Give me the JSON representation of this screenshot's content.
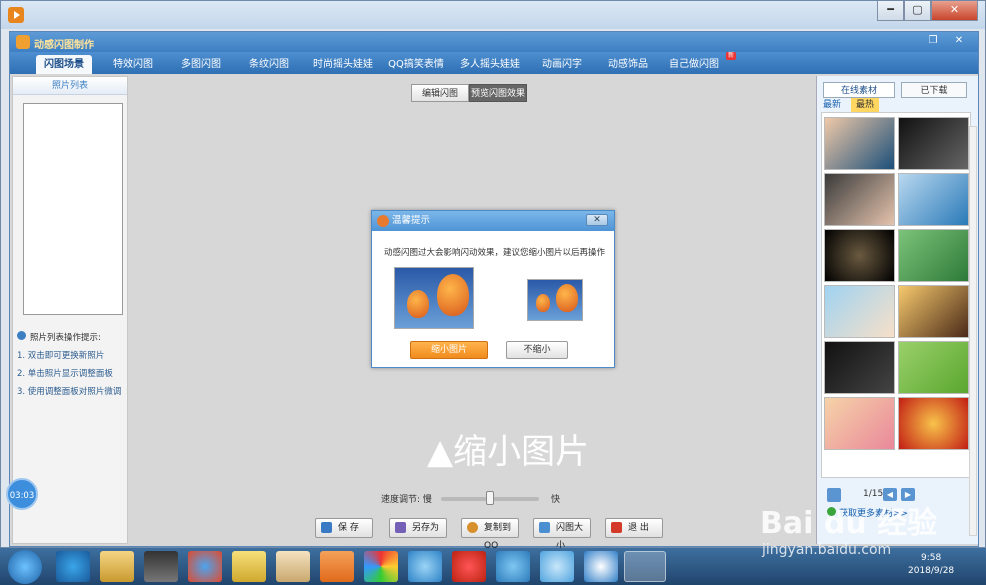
{
  "app": {
    "title": "动感闪图制作"
  },
  "window_controls": {
    "minimize": "━",
    "maximize": "▢",
    "close": "✕"
  },
  "inner_controls": {
    "restore": "❐",
    "close": "✕"
  },
  "tabs": [
    "闪图场景",
    "特效闪图",
    "多图闪图",
    "条纹闪图",
    "时尚摇头娃娃",
    "QQ搞笑表情",
    "多人摇头娃娃",
    "动画闪字",
    "动感饰品",
    "自己做闪图"
  ],
  "tab_badge": "新",
  "photo_panel": {
    "header": "照片列表",
    "tips_title": "照片列表操作提示:",
    "tips": [
      "1. 双击即可更换新照片",
      "2. 单击照片显示调整面板",
      "3. 使用调整面板对照片微调"
    ]
  },
  "center": {
    "segments": [
      "编辑闪图",
      "预览闪图效果"
    ],
    "caption": "▲缩小图片",
    "speed_label": "速度调节: 慢",
    "speed_fast": "快",
    "speed_value": 0.5,
    "buttons": [
      "保 存",
      "另存为",
      "复制到QQ",
      "闪图大小",
      "退 出"
    ]
  },
  "dialog": {
    "title": "温馨提示",
    "message": "动感闪图过大会影响闪动效果，建议您缩小图片以后再操作",
    "shrink_button": "缩小图片",
    "noshrink_button": "不缩小",
    "close": "✕"
  },
  "materials": {
    "tabs": [
      "在线素材",
      "已下载"
    ],
    "categories": [
      "最新",
      "最热"
    ],
    "pager": "1/15",
    "more_link": "获取更多素材>>"
  },
  "recorder": {
    "time": "03:03"
  },
  "taskbar": {
    "time": "9:58",
    "date": "2018/9/28"
  },
  "watermark": {
    "logo": "Bai du 经验",
    "url": "jingyan.baidu.com"
  },
  "colors": {
    "accent": "#3d7fc3",
    "shrink_button": "#f08c1e"
  }
}
